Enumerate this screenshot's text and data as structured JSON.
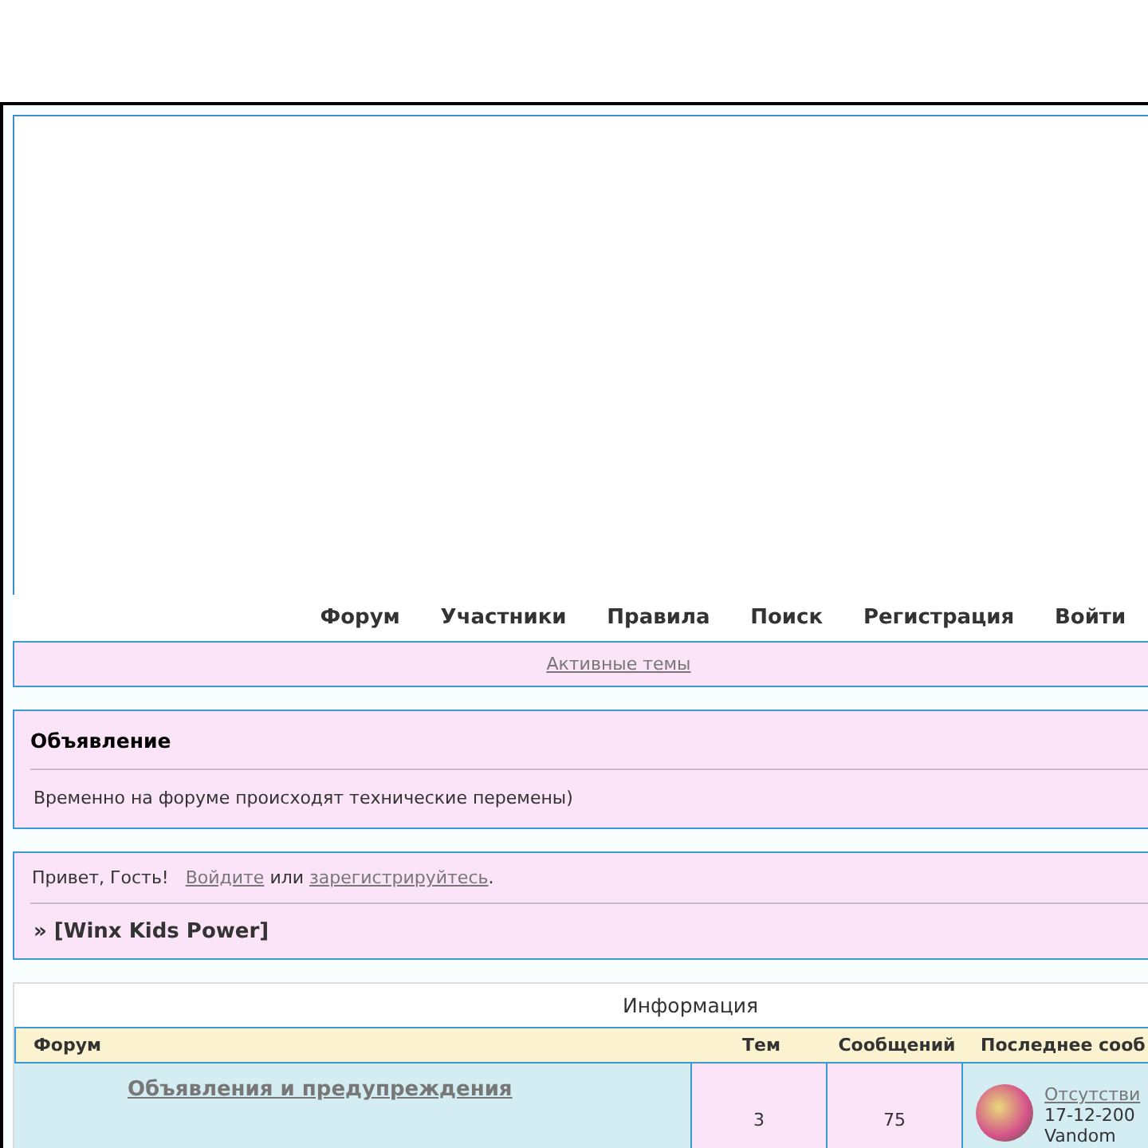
{
  "nav": [
    {
      "label": "Форум"
    },
    {
      "label": "Участники"
    },
    {
      "label": "Правила"
    },
    {
      "label": "Поиск"
    },
    {
      "label": "Регистрация"
    },
    {
      "label": "Войти"
    }
  ],
  "active_topics": "Активные темы",
  "announcement": {
    "title": "Объявление",
    "text": "Временно на форуме происходят технические перемены)"
  },
  "welcome": {
    "greeting": "Привет, Гость!",
    "login_link": "Войдите",
    "or": "или",
    "register_link": "зарегистрируйтесь",
    "period": ".",
    "board": "» [Winx Kids Power]"
  },
  "forum_table": {
    "title": "Информация",
    "columns": [
      "Форум",
      "Тем",
      "Сообщений",
      "Последнее сооб"
    ],
    "rows": [
      {
        "forum": "Объявления и предупреждения",
        "topics": "3",
        "posts": "75",
        "last_post": {
          "topic": "Отсутстви",
          "date": "17-12-200",
          "author": "Vandom"
        }
      }
    ]
  }
}
